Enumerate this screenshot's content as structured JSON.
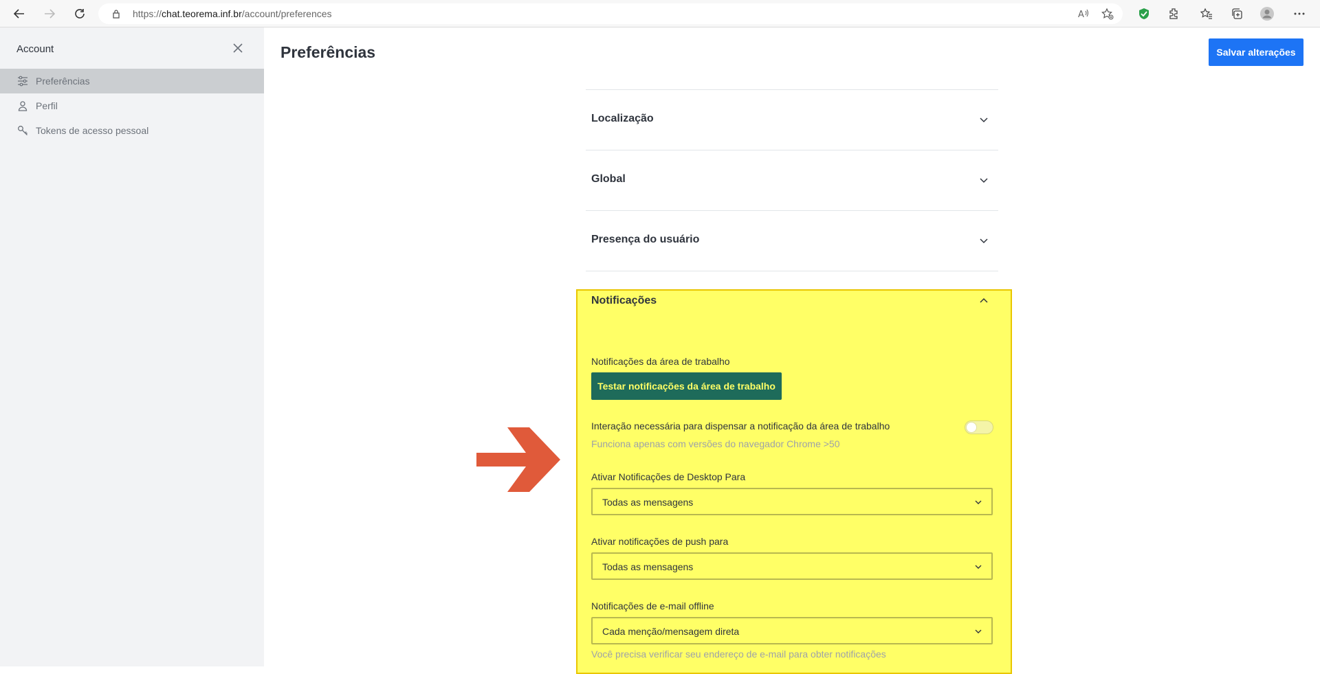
{
  "browser": {
    "url_prefix": "https://",
    "url_host": "chat.teorema.inf.br",
    "url_path": "/account/preferences"
  },
  "sidebar": {
    "title": "Account",
    "items": [
      {
        "label": "Preferências",
        "icon": "sliders-icon",
        "active": true
      },
      {
        "label": "Perfil",
        "icon": "user-icon",
        "active": false
      },
      {
        "label": "Tokens de acesso pessoal",
        "icon": "key-icon",
        "active": false
      }
    ]
  },
  "header": {
    "title": "Preferências",
    "save_label": "Salvar alterações"
  },
  "sections": [
    {
      "title": "Localização",
      "expanded": false
    },
    {
      "title": "Global",
      "expanded": false
    },
    {
      "title": "Presença do usuário",
      "expanded": false
    },
    {
      "title": "Notificações",
      "expanded": true
    }
  ],
  "notifications": {
    "desktop_label": "Notificações da área de trabalho",
    "test_button": "Testar notificações da área de trabalho",
    "interaction_label": "Interação necessária para dispensar a notificação da área de trabalho",
    "interaction_hint": "Funciona apenas com versões do navegador Chrome >50",
    "interaction_enabled": false,
    "desktop_for_label": "Ativar Notificações de Desktop Para",
    "desktop_for_value": "Todas as mensagens",
    "push_label": "Ativar notificações de push para",
    "push_value": "Todas as mensagens",
    "email_label": "Notificações de e-mail offline",
    "email_value": "Cada menção/mensagem direta",
    "email_hint": "Você precisa verificar seu endereço de e-mail para obter notificações"
  },
  "colors": {
    "primary": "#1d74f5",
    "highlight": "#ffff66",
    "test_button": "#1e6b5a",
    "annotation_arrow": "#e05a3a"
  }
}
